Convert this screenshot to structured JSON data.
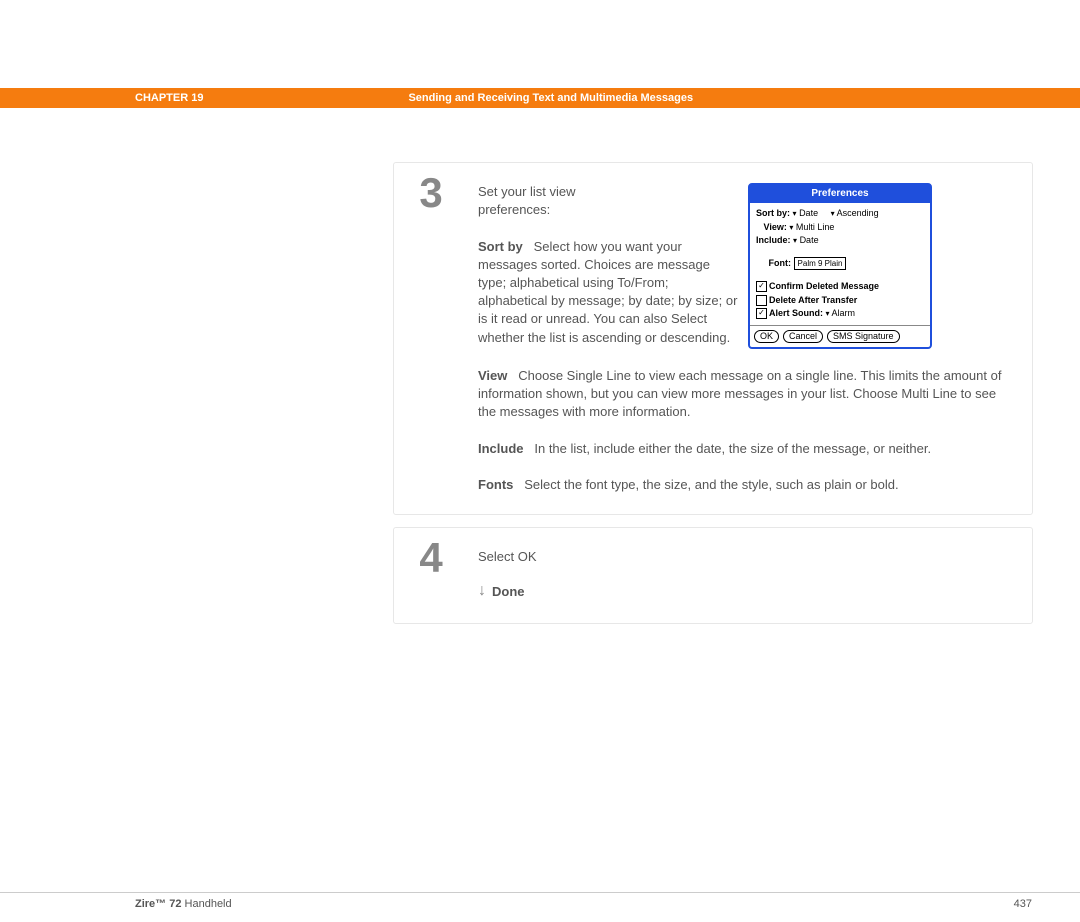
{
  "header": {
    "chapter": "CHAPTER 19",
    "title": "Sending and Receiving Text and Multimedia Messages"
  },
  "step3": {
    "number": "3",
    "intro1": "Set your list view",
    "intro2": "preferences:",
    "sortby_label": "Sort by",
    "sortby_text": "Select how you want your messages sorted. Choices are message type; alphabetical using To/From; alphabetical by message; by date; by size; or is it read or unread. You can also Select whether the list is ascending or descending.",
    "view_label": "View",
    "view_text": "Choose Single Line to view each message on a single line. This limits the amount of information shown, but you can view more messages in your list. Choose Multi Line to see the messages with more information.",
    "include_label": "Include",
    "include_text": "In the list, include either the date, the size of the message, or neither.",
    "fonts_label": "Fonts",
    "fonts_text": "Select the font type, the size, and the style, such as plain or bold."
  },
  "prefs": {
    "title": "Preferences",
    "sortby": "Sort by:",
    "sortby_val": "Date",
    "order_val": "Ascending",
    "view": "View:",
    "view_val": "Multi Line",
    "include": "Include:",
    "include_val": "Date",
    "font": "Font:",
    "font_val": "Palm 9 Plain",
    "confirm": "Confirm Deleted Message",
    "delete_after": "Delete After Transfer",
    "alert_sound": "Alert Sound:",
    "alert_val": "Alarm",
    "ok": "OK",
    "cancel": "Cancel",
    "sig": "SMS Signature"
  },
  "step4": {
    "number": "4",
    "text": "Select OK",
    "done": "Done"
  },
  "footer": {
    "product_bold": "Zire™ 72",
    "product_rest": " Handheld",
    "page": "437"
  }
}
